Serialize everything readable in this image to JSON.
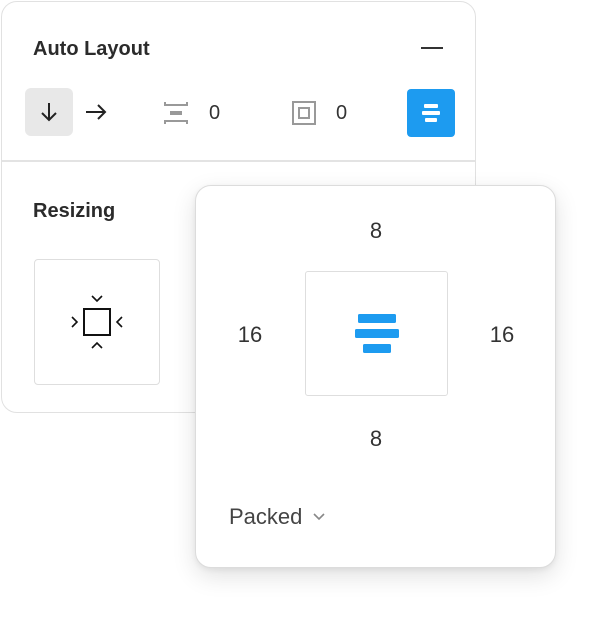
{
  "auto_layout": {
    "title": "Auto Layout",
    "item_spacing": "0",
    "padding": "0"
  },
  "resizing": {
    "title": "Resizing"
  },
  "popover": {
    "padding_top": "8",
    "padding_left": "16",
    "padding_right": "16",
    "padding_bottom": "8",
    "spacing_mode": "Packed"
  },
  "colors": {
    "accent": "#1d9bf0"
  },
  "icons": {
    "direction_vertical": "arrow-down-icon",
    "direction_horizontal": "arrow-right-icon",
    "item_spacing": "spacing-icon",
    "padding": "padding-icon",
    "alignment": "align-center-icon",
    "collapse": "minus-icon",
    "resize": "hug-contents-icon",
    "dropdown": "chevron-down-icon"
  }
}
